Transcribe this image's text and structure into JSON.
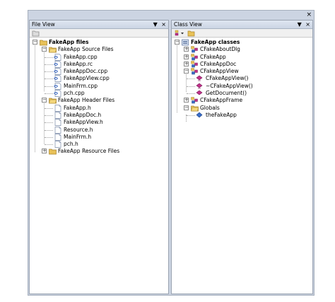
{
  "frame": {
    "close_glyph": "×"
  },
  "file_view": {
    "title": "File View",
    "dropdown_glyph": "▼",
    "close_glyph": "×",
    "tree": {
      "root": "FakeApp files",
      "source": {
        "label": "FakeApp Source Files",
        "files": [
          "FakeApp.cpp",
          "FakeApp.rc",
          "FakeAppDoc.cpp",
          "FakeAppView.cpp",
          "MainFrm.cpp",
          "pch.cpp"
        ]
      },
      "header": {
        "label": "FakeApp Header Files",
        "files": [
          "FakeApp.h",
          "FakeAppDoc.h",
          "FakeAppView.h",
          "Resource.h",
          "MainFrm.h",
          "pch.h"
        ]
      },
      "resource": {
        "label": "FakeApp Resource Files"
      }
    }
  },
  "class_view": {
    "title": "Class View",
    "dropdown_glyph": "▼",
    "close_glyph": "×",
    "tree": {
      "root": "FakeApp classes",
      "classes": [
        "CFakeAboutDlg",
        "CFakeApp",
        "CFakeAppDoc",
        "CFakeAppView"
      ],
      "view_members": [
        "CFakeAppView()",
        "~CFakeAppView()",
        "GetDocument()"
      ],
      "frame_class": "CFakeAppFrame",
      "globals": {
        "label": "Globals",
        "items": [
          "theFakeApp"
        ]
      }
    }
  },
  "icons": {
    "folder": "folder-icon",
    "project": "project-icon",
    "cpp_file": "cpp-file-icon",
    "header_file": "header-file-icon",
    "class": "class-icon",
    "method": "method-icon",
    "global_var": "global-variable-icon"
  },
  "colors": {
    "folder_yellow": "#e8c158",
    "frame_blue": "#ccd4e2",
    "method_magenta": "#c0308a",
    "global_blue": "#3a6ec8"
  }
}
